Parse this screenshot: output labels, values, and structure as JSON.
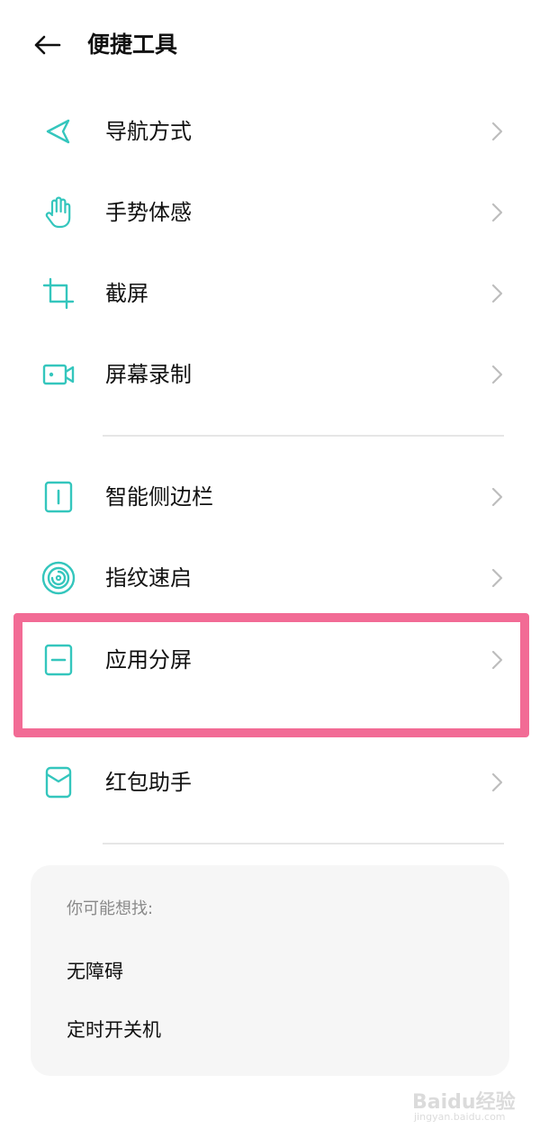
{
  "header": {
    "back_icon": "arrow-left-icon",
    "title": "便捷工具"
  },
  "colors": {
    "accent": "#34c6bd",
    "highlight_border": "#f26b95",
    "divider": "#e6e6e6",
    "chevron": "#bdbdbd",
    "card_bg": "#f6f6f6"
  },
  "section1": {
    "items": [
      {
        "label": "导航方式",
        "icon": "navigation-arrow-icon"
      },
      {
        "label": "手势体感",
        "icon": "hand-gesture-icon"
      },
      {
        "label": "截屏",
        "icon": "crop-screenshot-icon"
      },
      {
        "label": "屏幕录制",
        "icon": "screen-record-icon"
      }
    ]
  },
  "section2": {
    "items": [
      {
        "label": "智能侧边栏",
        "icon": "sidebar-icon"
      },
      {
        "label": "指纹速启",
        "icon": "fingerprint-icon"
      },
      {
        "label": "应用分屏",
        "icon": "split-screen-icon",
        "highlighted": true
      },
      {
        "label": "红包助手",
        "icon": "red-envelope-icon"
      }
    ]
  },
  "suggestions": {
    "title": "你可能想找:",
    "items": [
      "无障碍",
      "定时开关机"
    ]
  },
  "watermark": {
    "brand": "Baidu经验",
    "url": "jingyan.baidu.com"
  }
}
